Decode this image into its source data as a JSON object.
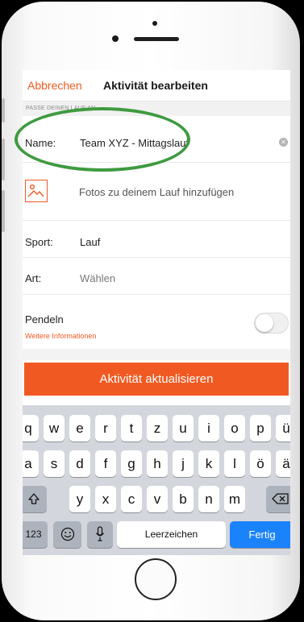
{
  "nav": {
    "cancel_label": "Abbrechen",
    "title": "Aktivität bearbeiten"
  },
  "section": {
    "header": "PASSE DEINEN LAUF AN"
  },
  "form": {
    "name_label": "Name:",
    "name_value": "Team XYZ - Mittagslauf",
    "add_photos": "Fotos zu deinem Lauf hinzufügen",
    "sport_label": "Sport:",
    "sport_value": "Lauf",
    "type_label": "Art:",
    "type_value": "Wählen",
    "commute_label": "Pendeln",
    "more_info": "Weitere Informationen",
    "commute_enabled": false
  },
  "update_button": "Aktivität aktualisieren",
  "keyboard": {
    "row1": [
      "q",
      "w",
      "e",
      "r",
      "t",
      "z",
      "u",
      "i",
      "o",
      "p",
      "ü"
    ],
    "row2": [
      "a",
      "s",
      "d",
      "f",
      "g",
      "h",
      "j",
      "k",
      "l",
      "ö",
      "ä"
    ],
    "row3": [
      "y",
      "x",
      "c",
      "v",
      "b",
      "n",
      "m"
    ],
    "numbers_key": "123",
    "space_key": "Leerzeichen",
    "return_key": "Fertig",
    "icons": {
      "shift": "shift-icon",
      "delete": "delete-icon",
      "emoji": "emoji-icon",
      "mic": "microphone-icon"
    }
  },
  "colors": {
    "accent": "#f05a22",
    "annotation": "#3f9a40",
    "return_key": "#1a82fb"
  }
}
